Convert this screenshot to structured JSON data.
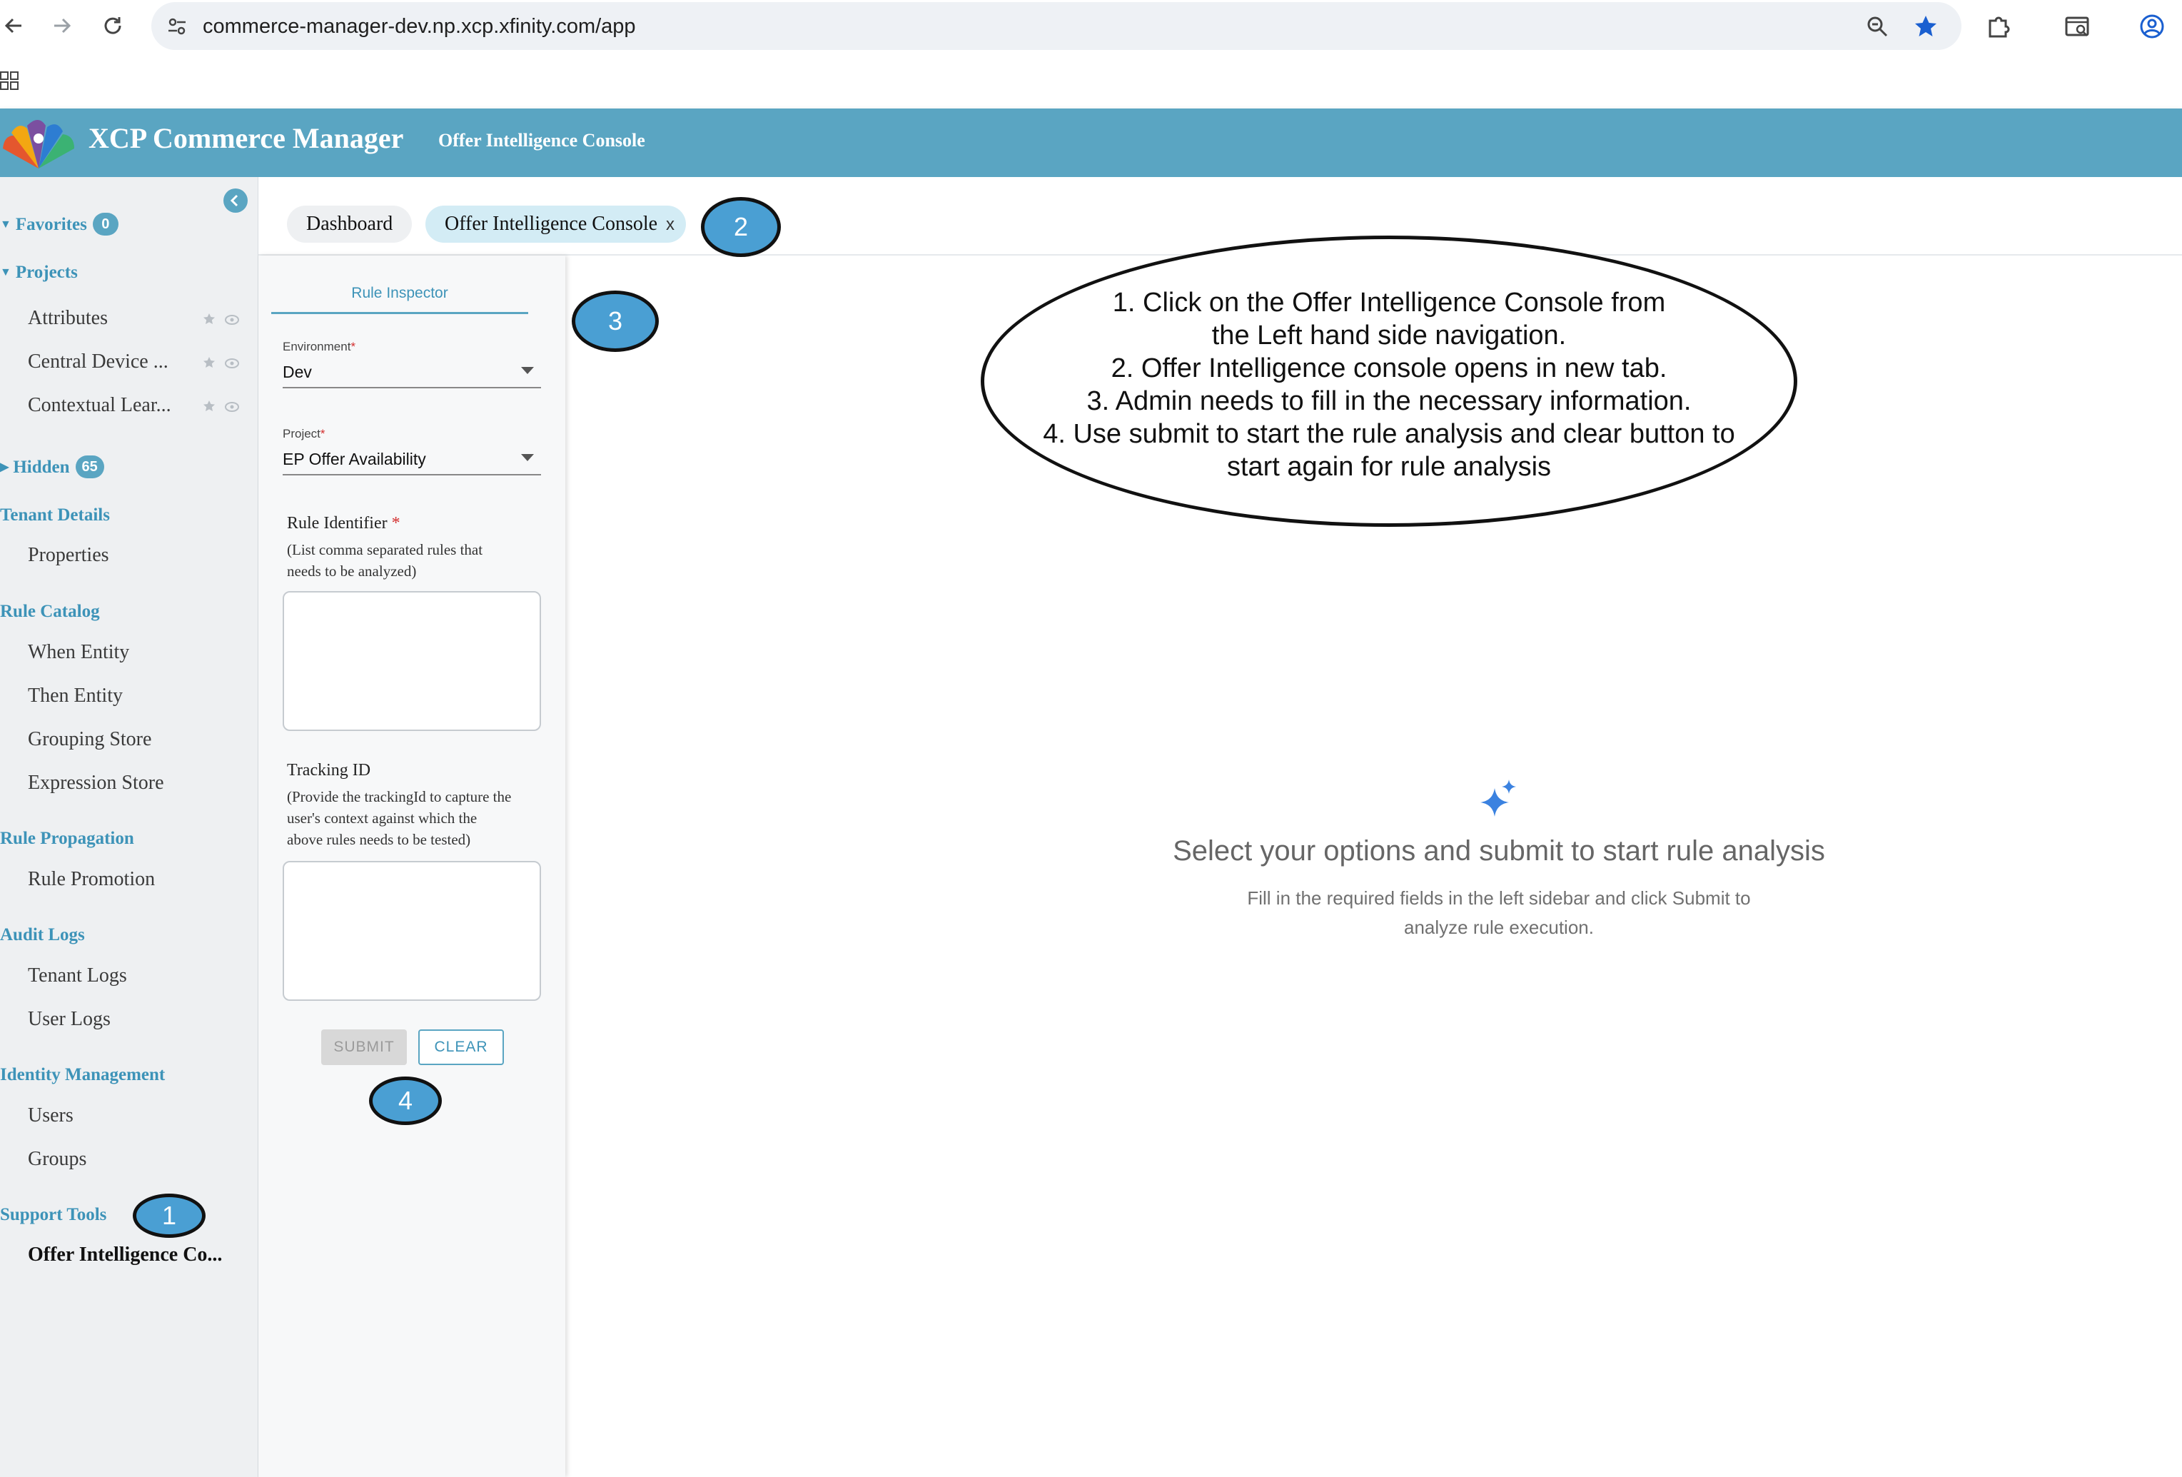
{
  "browser": {
    "url": "commerce-manager-dev.np.xcp.xfinity.com/app",
    "icons": [
      "back-arrow-icon",
      "forward-arrow-icon",
      "reload-icon",
      "site-settings-icon",
      "zoom-icon",
      "bookmark-star-icon",
      "extensions-icon",
      "tab-search-icon",
      "profile-icon",
      "apps-grid-icon"
    ]
  },
  "header": {
    "title": "XCP Commerce Manager",
    "subtitle": "Offer Intelligence Console",
    "color": "#5aa5c2"
  },
  "sidebar": {
    "favorites": {
      "label": "Favorites",
      "count": "0"
    },
    "projects": {
      "label": "Projects",
      "items": [
        "Attributes",
        "Central Device ...",
        "Contextual Lear..."
      ]
    },
    "hidden": {
      "label": "Hidden",
      "count": "65"
    },
    "groups": [
      {
        "label": "Tenant Details",
        "items": [
          "Properties"
        ]
      },
      {
        "label": "Rule Catalog",
        "items": [
          "When Entity",
          "Then Entity",
          "Grouping Store",
          "Expression Store"
        ]
      },
      {
        "label": "Rule Propagation",
        "items": [
          "Rule Promotion"
        ]
      },
      {
        "label": "Audit Logs",
        "items": [
          "Tenant Logs",
          "User Logs"
        ]
      },
      {
        "label": "Identity Management",
        "items": [
          "Users",
          "Groups"
        ]
      },
      {
        "label": "Support Tools",
        "items": [
          "Offer Intelligence Co..."
        ]
      }
    ]
  },
  "tabs": [
    {
      "label": "Dashboard"
    },
    {
      "label": "Offer Intelligence Console",
      "close": "x"
    }
  ],
  "inspector": {
    "tab_label": "Rule Inspector",
    "environment": {
      "label": "Environment",
      "value": "Dev"
    },
    "project": {
      "label": "Project",
      "value": "EP Offer Availability"
    },
    "rule_identifier": {
      "label": "Rule Identifier",
      "help_line1": "(List comma separated rules that",
      "help_line2": "needs to be analyzed)"
    },
    "tracking_id": {
      "label": "Tracking ID",
      "help_line1": "(Provide the trackingId to capture the",
      "help_line2": "user's context against which the",
      "help_line3": "above rules needs to be tested)"
    },
    "submit_label": "SUBMIT",
    "clear_label": "CLEAR",
    "required_mark": "*"
  },
  "main": {
    "empty_title": "Select your options and submit to start rule analysis",
    "empty_sub_line1": "Fill in the required fields in the left sidebar and click Submit to",
    "empty_sub_line2": "analyze rule execution."
  },
  "annotations": {
    "markers": [
      "1",
      "2",
      "3",
      "4"
    ],
    "callout_lines": [
      "1. Click on the Offer Intelligence Console from",
      "the Left hand side navigation.",
      "2. Offer Intelligence console opens in new tab.",
      "3. Admin needs to fill in the necessary information.",
      "4. Use submit to start the rule analysis and clear button to",
      "start again for rule analysis"
    ],
    "marker_color": "#4a9fd3"
  }
}
